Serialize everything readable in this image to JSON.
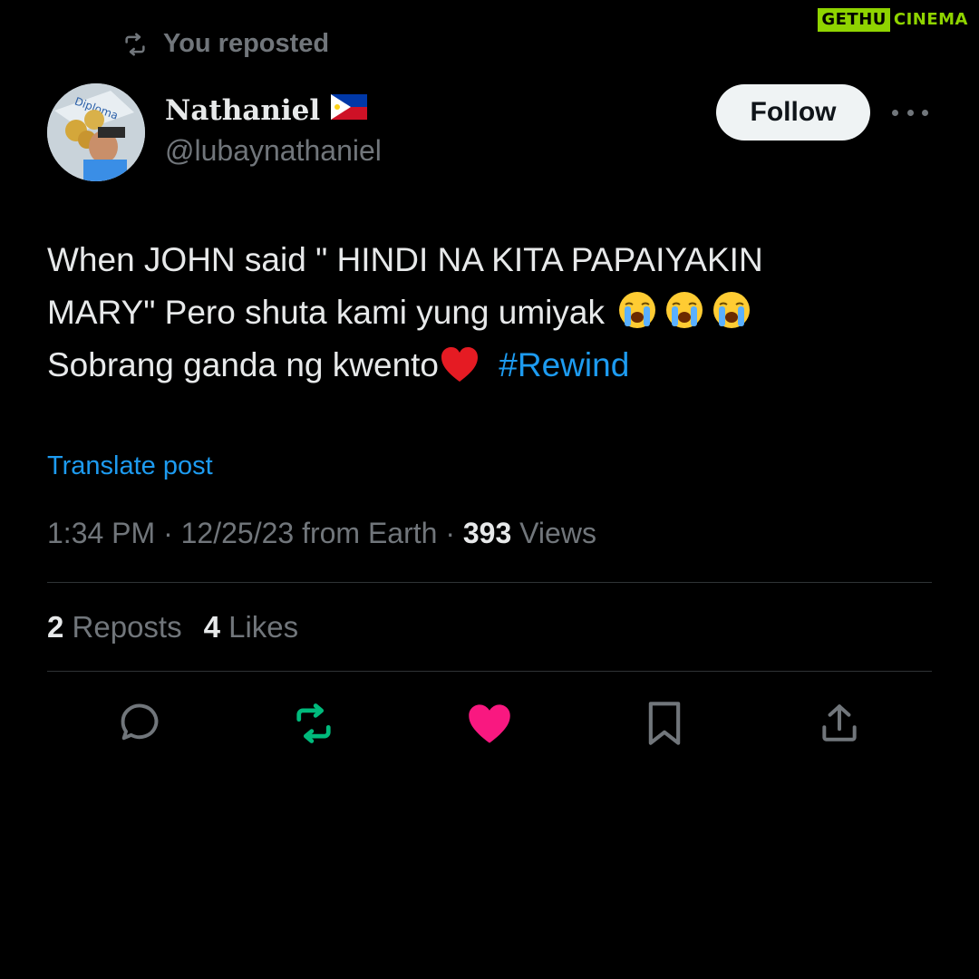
{
  "watermark": {
    "part1": "GETHU",
    "part2": "CINEMA"
  },
  "repost_header": {
    "label": "You reposted"
  },
  "author": {
    "name": "Nathaniel",
    "handle": "@lubaynathaniel",
    "flag_icon": "philippines-flag-icon"
  },
  "follow_button": {
    "label": "Follow"
  },
  "tweet": {
    "line1": "When JOHN said \" HINDI NA KITA PAPAIYAKIN",
    "line2": "MARY\" Pero shuta kami yung umiyak",
    "line3": "Sobrang ganda ng kwento",
    "hashtag": "#Rewind"
  },
  "translate_label": "Translate post",
  "meta": {
    "time": "1:34 PM",
    "date": "12/25/23",
    "source": "from Earth",
    "views_count": "393",
    "views_label": "Views"
  },
  "stats": {
    "reposts_count": "2",
    "reposts_label": "Reposts",
    "likes_count": "4",
    "likes_label": "Likes"
  },
  "colors": {
    "background": "#000000",
    "text": "#e7e9ea",
    "muted": "#71767b",
    "link": "#1d9bf0",
    "repost_active": "#00ba7c",
    "like_active": "#f91880"
  }
}
